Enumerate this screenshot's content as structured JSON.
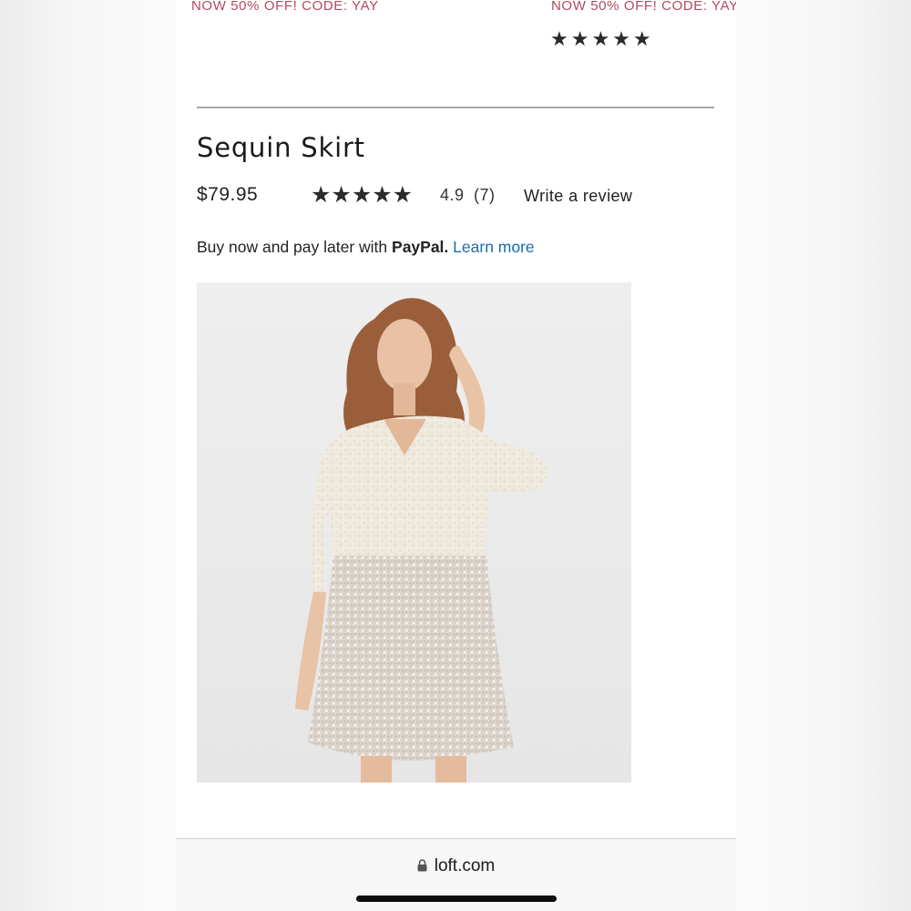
{
  "promos": {
    "left_text": "NOW 50% OFF! CODE: YAY",
    "right_text": "NOW 50% OFF! CODE: YAY"
  },
  "top_rating_stars": "★★★★★",
  "product": {
    "title": "Sequin Skirt",
    "price": "$79.95",
    "rating_stars": "★★★★★",
    "rating_score": "4.9",
    "rating_count": "(7)",
    "write_review_label": "Write a review"
  },
  "paypal": {
    "prefix": "Buy now and pay later with ",
    "brand": "PayPal.",
    "link": "Learn more"
  },
  "browser": {
    "url": "loft.com"
  },
  "colors": {
    "promo": "#b34a5e",
    "link": "#1a6cb0"
  },
  "icons": [
    "star-icon",
    "lock-icon"
  ]
}
